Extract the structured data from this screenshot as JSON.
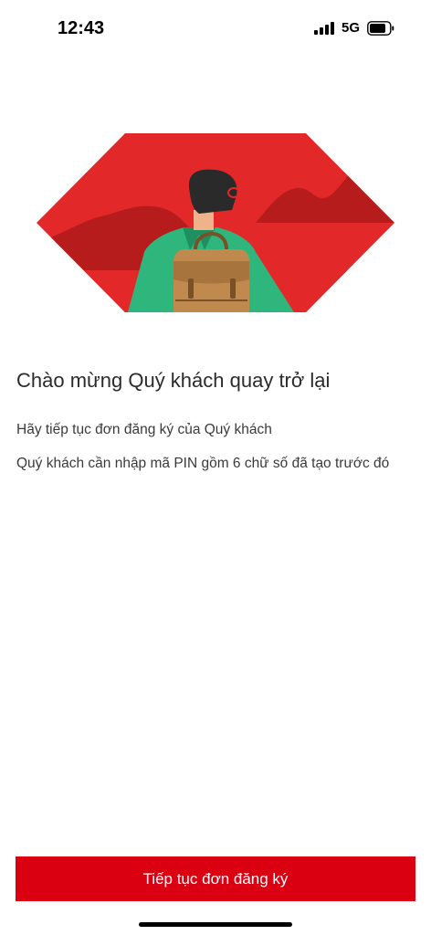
{
  "status_bar": {
    "time": "12:43",
    "network": "5G"
  },
  "illustration": {
    "icon": "person-with-backpack-illustration",
    "colors": {
      "background": "#e3282a",
      "hills": "#b71c1c",
      "jacket": "#2eb67d",
      "backpack": "#c08a4e",
      "hair": "#2a2a2a"
    }
  },
  "content": {
    "title": "Chào mừng Quý khách quay trở lại",
    "line1": "Hãy tiếp tục đơn đăng ký của Quý khách",
    "line2": "Quý khách cần nhập mã PIN gồm 6 chữ số đã tạo trước đó"
  },
  "actions": {
    "continue_label": "Tiếp tục đơn đăng ký",
    "accent": "#db0011"
  }
}
